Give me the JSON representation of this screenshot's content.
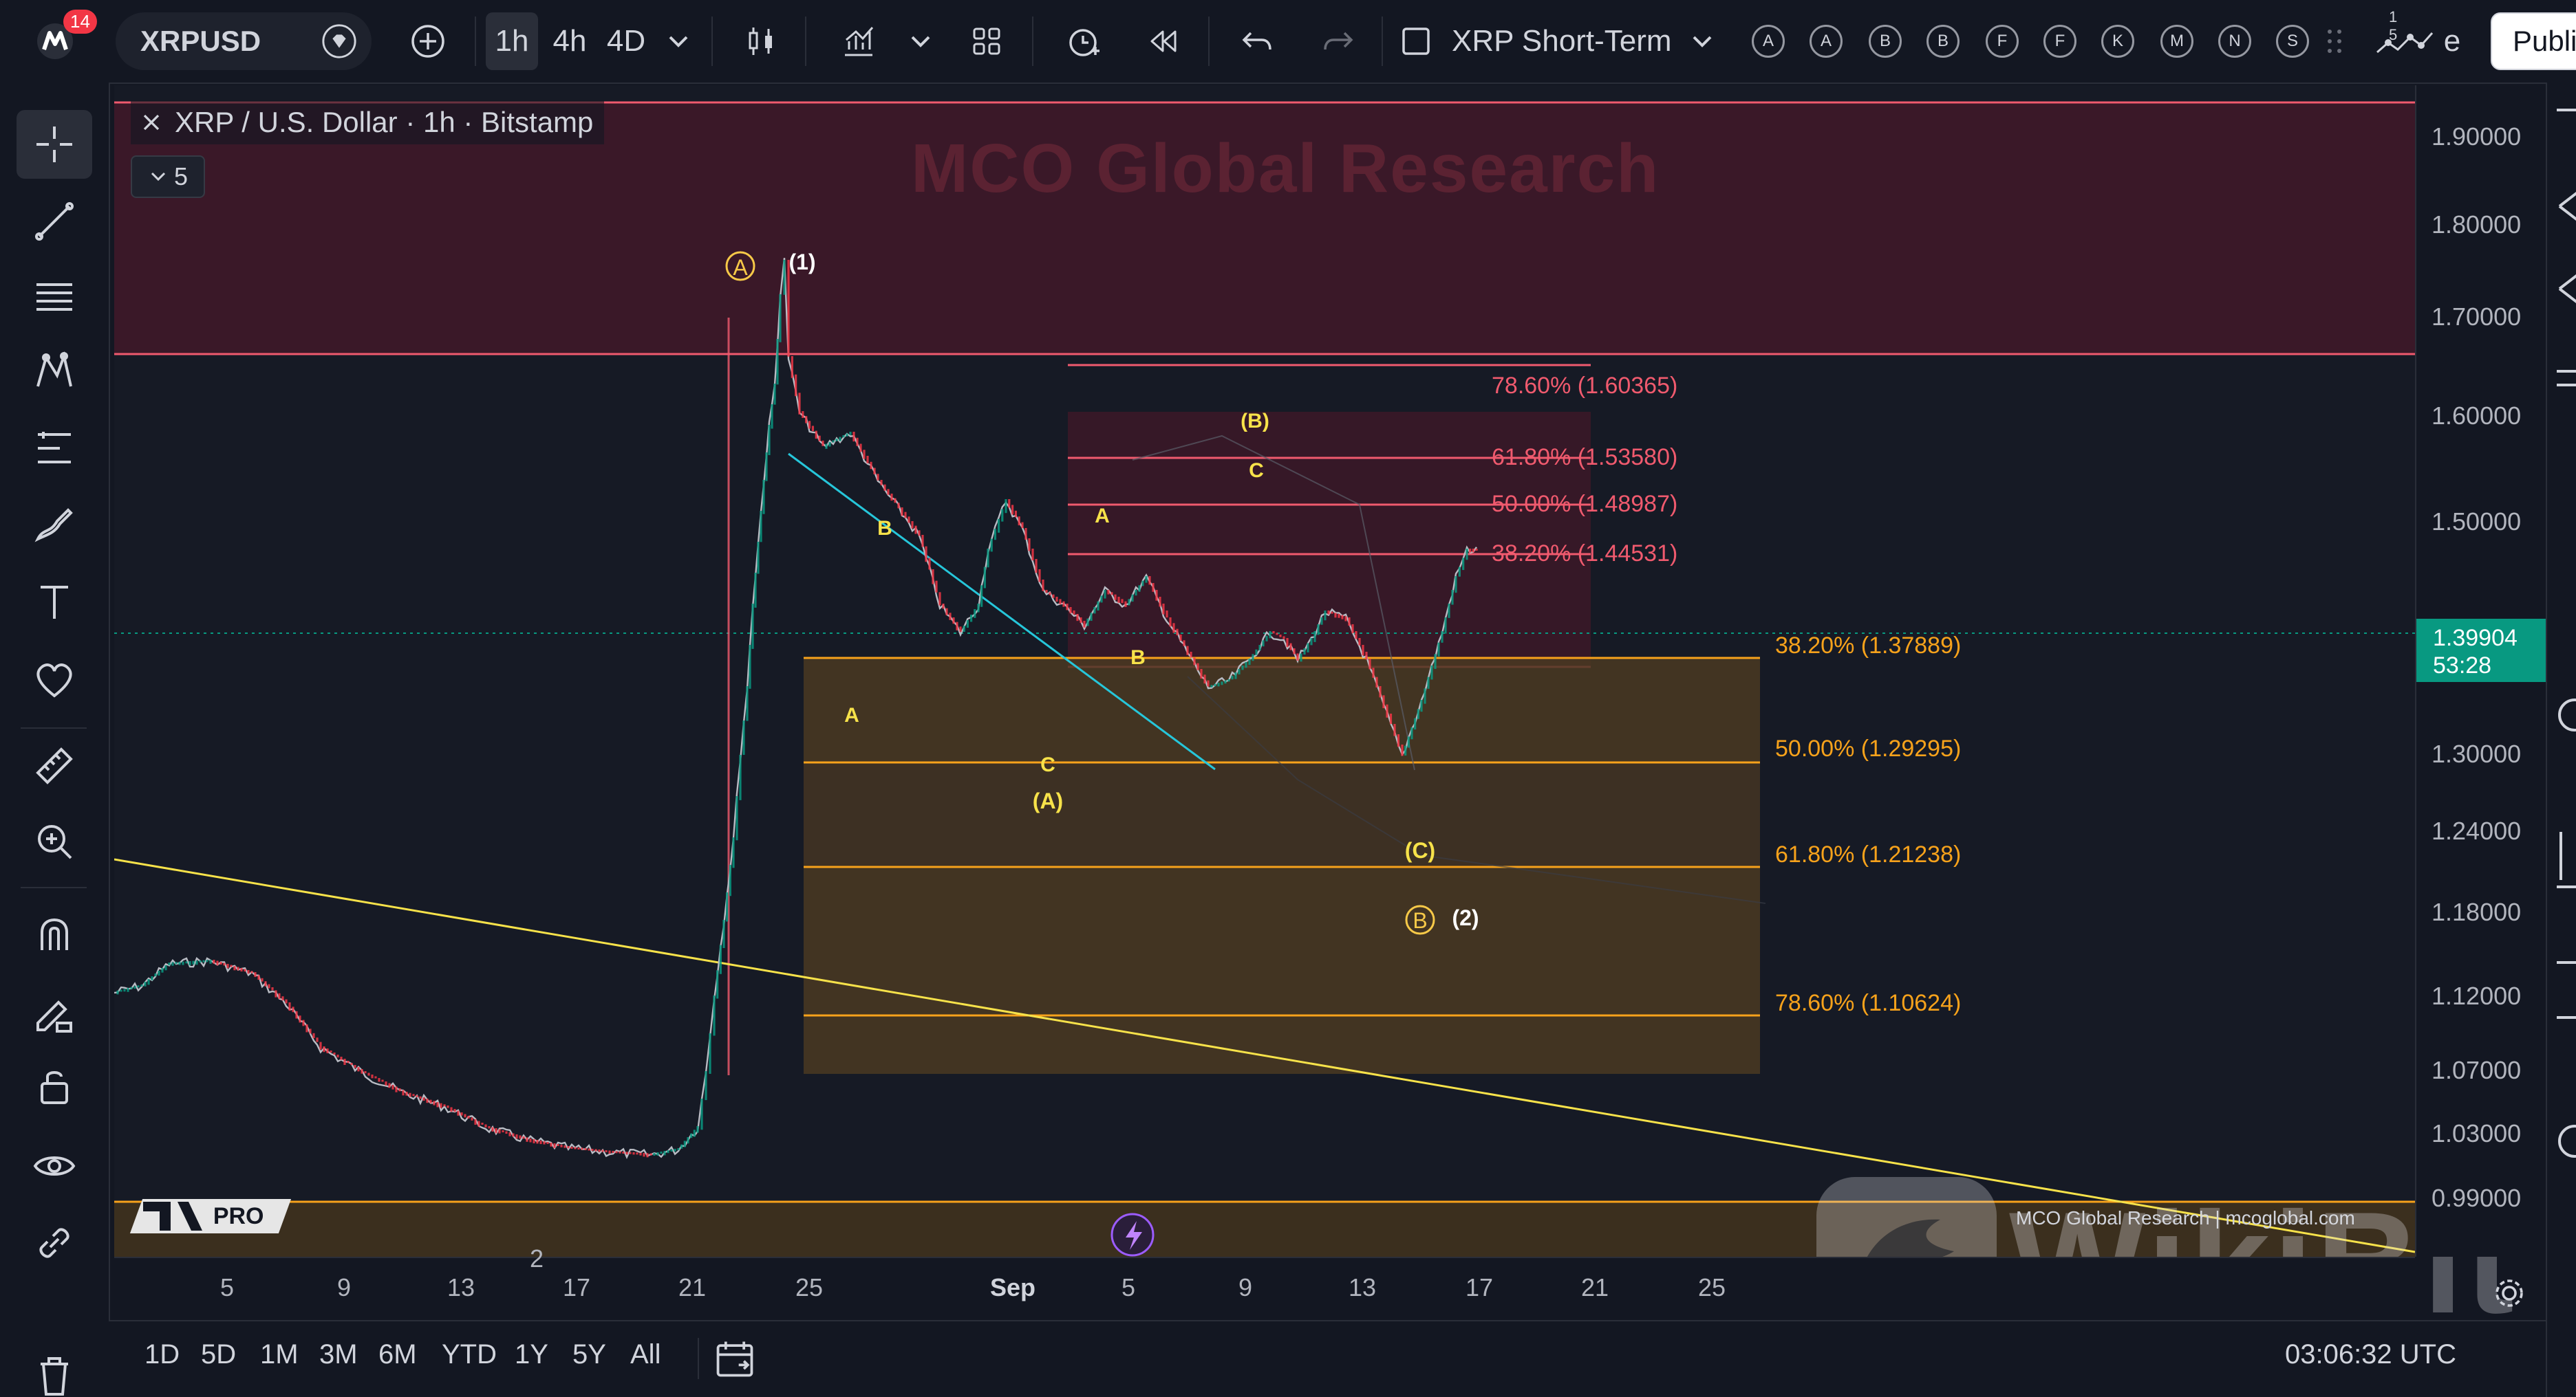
{
  "topbar": {
    "notification_count": "14",
    "symbol": "XRPUSD",
    "timeframes": [
      "1h",
      "4h",
      "4D"
    ],
    "active_timeframe": "1h",
    "layout_name": "XRP Short-Term",
    "alert_buttons": [
      "A",
      "A",
      "B",
      "B",
      "F",
      "F",
      "K",
      "M",
      "N",
      "S"
    ],
    "stats_badge": "1 5",
    "extra_text": "e",
    "publish_label": "Publi"
  },
  "legend": {
    "title": "XRP / U.S. Dollar · 1h · Bitstamp",
    "indicator_count": "5"
  },
  "watermark": "MCO Global Research",
  "price_axis": {
    "labels": [
      "1.90000",
      "1.80000",
      "1.70000",
      "1.60000",
      "1.50000",
      "1.30000",
      "1.24000",
      "1.18000",
      "1.12000",
      "1.07000",
      "1.03000",
      "0.99000"
    ],
    "current_price": "1.39904",
    "countdown": "53:28"
  },
  "time_axis": {
    "labels": [
      "5",
      "9",
      "13",
      "17",
      "21",
      "25",
      "Sep",
      "5",
      "9",
      "13",
      "17",
      "21",
      "25"
    ],
    "partial_label": "2"
  },
  "fib_upper": {
    "levels": [
      "78.60% (1.60365)",
      "61.80% (1.53580)",
      "50.00% (1.48987)",
      "38.20% (1.44531)"
    ],
    "color": "#f05a6e"
  },
  "fib_lower": {
    "levels": [
      "38.20% (1.37889)",
      "50.00% (1.29295)",
      "61.80% (1.21238)",
      "78.60% (1.10624)"
    ],
    "color": "#f7a21b"
  },
  "wave_labels": {
    "circled_a": "A",
    "one": "(1)",
    "b_small": "B",
    "a_small": "A",
    "c_small": "C",
    "big_a": "(A)",
    "right_a": "A",
    "right_b": "B",
    "paren_b": "(B)",
    "right_c": "C",
    "paren_c": "(C)",
    "circled_b": "B",
    "two": "(2)"
  },
  "logo": {
    "badge": "PRO"
  },
  "footer_credit": "MCO Global Research | mcoglobal.com",
  "wikibit": "WikiBit",
  "bottombar": {
    "ranges": [
      "1D",
      "5D",
      "1M",
      "3M",
      "6M",
      "YTD",
      "1Y",
      "5Y",
      "All"
    ],
    "clock": "03:06:32 UTC"
  },
  "colors": {
    "up": "#089981",
    "down": "#f23645",
    "fib_zone_fill": "#5a4321",
    "resistance_fill": "#3a1828"
  }
}
